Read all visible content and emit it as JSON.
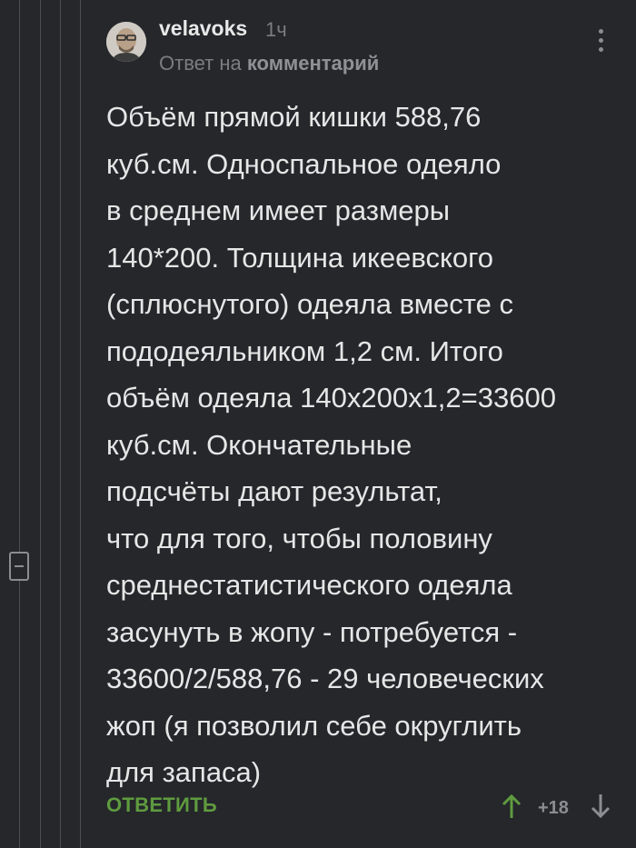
{
  "comment": {
    "author": "velavoks",
    "time": "1ч",
    "reply_prefix": "Ответ на ",
    "reply_target": "комментарий",
    "text": "Объём прямой кишки 588,76\nкуб.см. Односпальное одеяло\nв среднем имеет размеры\n140*200. Толщина икеевского\n(сплюснутого) одеяла вместе с\npododеяльником 1,2 см. Итого\nобъём одеяла 140х200х1,2=33600\nкуб.см. Окончательные\nподсчёты дают результат,\nчто для того, чтобы половину\nсреднестатистического одеяла\nзасунуть в жопу - потребуется -\n33600/2/588,76 - 29 человеческих\nжоп (я позволил себе округлить\nдля запаса)",
    "reply_label": "ОТВЕТИТЬ",
    "rating": "+18"
  },
  "icons": {
    "avatar": "avatar",
    "more": "more-vertical-icon",
    "collapse": "minus-box-icon",
    "upvote": "arrow-up-icon",
    "downvote": "arrow-down-icon"
  },
  "colors": {
    "background": "#25272b",
    "reply_green": "#5f9b3f",
    "upvote_green": "#5f9b3f",
    "muted": "#7a7d82"
  }
}
